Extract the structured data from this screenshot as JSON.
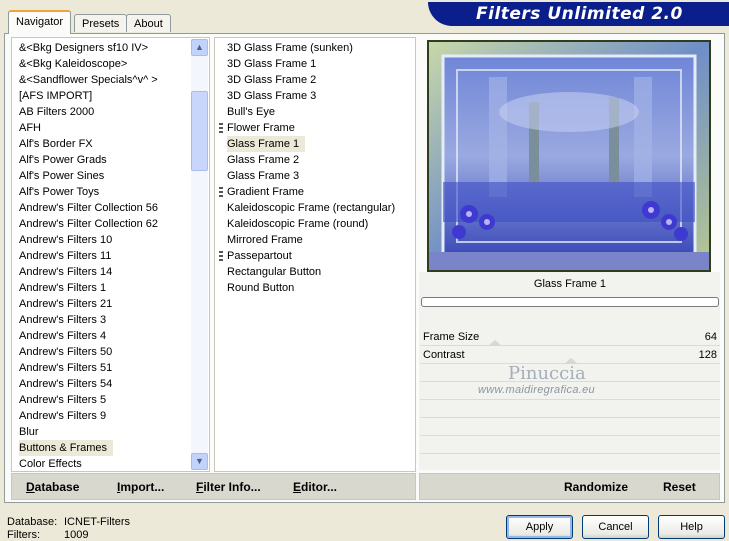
{
  "tabs": [
    {
      "label": "Navigator",
      "active": true
    },
    {
      "label": "Presets",
      "active": false
    },
    {
      "label": "About",
      "active": false
    }
  ],
  "banner": {
    "title": "Filters Unlimited 2.0",
    "color": "#0b1f8c"
  },
  "categories": {
    "items": [
      "&<Bkg Designers sf10 IV>",
      "&<Bkg Kaleidoscope>",
      "&<Sandflower Specials^v^ >",
      "[AFS IMPORT]",
      "AB Filters 2000",
      "AFH",
      "Alf's Border FX",
      "Alf's Power Grads",
      "Alf's Power Sines",
      "Alf's Power Toys",
      "Andrew's Filter Collection 56",
      "Andrew's Filter Collection 62",
      "Andrew's Filters 10",
      "Andrew's Filters 11",
      "Andrew's Filters 14",
      "Andrew's Filters 1",
      "Andrew's Filters 21",
      "Andrew's Filters 3",
      "Andrew's Filters 4",
      "Andrew's Filters 50",
      "Andrew's Filters 51",
      "Andrew's Filters 54",
      "Andrew's Filters 5",
      "Andrew's Filters 9",
      "Blur",
      "Buttons & Frames",
      "Color Effects"
    ],
    "selected_index": 25
  },
  "filters": {
    "items": [
      {
        "label": "3D Glass Frame (sunken)",
        "has_sub": false
      },
      {
        "label": "3D Glass Frame 1",
        "has_sub": false
      },
      {
        "label": "3D Glass Frame 2",
        "has_sub": false
      },
      {
        "label": "3D Glass Frame 3",
        "has_sub": false
      },
      {
        "label": "Bull's Eye",
        "has_sub": false
      },
      {
        "label": "Flower Frame",
        "has_sub": true
      },
      {
        "label": "Glass Frame 1",
        "has_sub": false
      },
      {
        "label": "Glass Frame 2",
        "has_sub": false
      },
      {
        "label": "Glass Frame 3",
        "has_sub": false
      },
      {
        "label": "Gradient Frame",
        "has_sub": true
      },
      {
        "label": "Kaleidoscopic Frame (rectangular)",
        "has_sub": false
      },
      {
        "label": "Kaleidoscopic Frame (round)",
        "has_sub": false
      },
      {
        "label": "Mirrored Frame",
        "has_sub": false
      },
      {
        "label": "Passepartout",
        "has_sub": true
      },
      {
        "label": "Rectangular Button",
        "has_sub": false
      },
      {
        "label": "Round Button",
        "has_sub": false
      }
    ],
    "selected_index": 6
  },
  "preview": {
    "filter_name": "Glass Frame 1",
    "progress": 0
  },
  "params": [
    {
      "label": "Frame Size",
      "value": "64"
    },
    {
      "label": "Contrast",
      "value": "128"
    }
  ],
  "watermark": {
    "name": "Pinuccia",
    "url": "www.maidiregrafica.eu"
  },
  "toolbar": {
    "database": "Database",
    "import": "Import...",
    "filter_info": "Filter Info...",
    "editor": "Editor...",
    "randomize": "Randomize",
    "reset": "Reset"
  },
  "footer": {
    "database_label": "Database:",
    "database_value": "ICNET-Filters",
    "filters_label": "Filters:",
    "filters_value": "1009",
    "apply": "Apply",
    "cancel": "Cancel",
    "help": "Help"
  }
}
